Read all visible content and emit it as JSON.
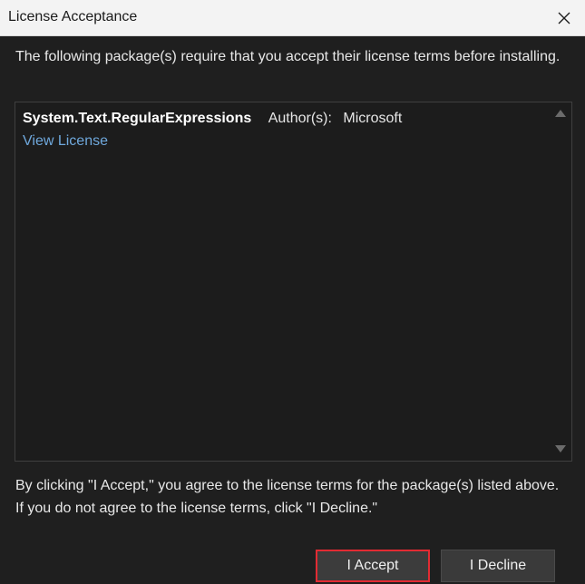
{
  "window": {
    "title": "License Acceptance",
    "close_icon": "close-icon"
  },
  "intro_text": "The following package(s) require that you accept their license terms before installing.",
  "packages": [
    {
      "name": "System.Text.RegularExpressions",
      "author_label": "Author(s):",
      "author": "Microsoft",
      "view_license_label": "View License"
    }
  ],
  "footer_text": "By clicking \"I Accept,\" you agree to the license terms for the package(s) listed above. If you do not agree to the license terms, click \"I Decline.\"",
  "buttons": {
    "accept_label": "I Accept",
    "decline_label": "I Decline"
  },
  "colors": {
    "background": "#1f1f1f",
    "link": "#6fa8dc",
    "highlight": "#e22b33"
  }
}
